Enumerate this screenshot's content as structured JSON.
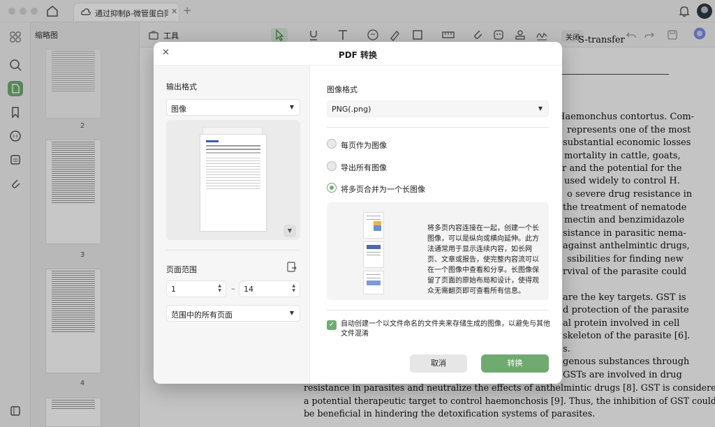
{
  "tab": {
    "title": "通过抑制β-微管蛋白同…"
  },
  "sidebar": {
    "thumbnails_title": "缩略图",
    "page_numbers": [
      "2",
      "3",
      "4"
    ]
  },
  "toolbar": {
    "tools_label": "工具",
    "close_label": "关闭"
  },
  "document": {
    "lines": [
      "S-transfer",
      "Haemonchus contortus. Com-",
      "represents one of the most",
      "substantial economic losses",
      "mortality in cattle, goats,",
      "r and the potential for the",
      "used widely to control H.",
      "o severe drug resistance in",
      "the treatment of nematode",
      "mectin and benzimidazole",
      "sistance in parasitic nema-",
      "against anthelmintic drugs,",
      "ssibilities for finding new",
      "rvival of the parasite could",
      "are the key targets. GST is",
      "d protection of the parasite",
      "al protein involved in cell",
      "skeleton of the parasite [6].",
      "s.",
      "genous substances through",
      "GSTs are involved in drug",
      "resistance in parasites and neutralize the effects of anthelmintic drugs [8]. GST is considered",
      "a potential therapeutic target to control haemonchosis [9]. Thus, the inhibition of GST could",
      "be beneficial in hindering the detoxification systems of parasites."
    ]
  },
  "dialog": {
    "title": "PDF 转换",
    "output_format_label": "输出格式",
    "output_format_value": "图像",
    "page_range_label": "页面范围",
    "page_from": "1",
    "page_to": "14",
    "range_dash": "–",
    "range_option": "范围中的所有页面",
    "image_format_label": "图像格式",
    "image_format_value": "PNG(.png)",
    "options": [
      {
        "label": "每页作为图像",
        "selected": false
      },
      {
        "label": "导出所有图像",
        "selected": false
      },
      {
        "label": "将多页合并为一个长图像",
        "selected": true
      }
    ],
    "description": "将多页内容连接在一起，创建一个长图像，可以是纵向或横向延伸。此方法通常用于显示连续内容，如长网页、文章或报告，使完整内容流可以在一个图像中查看和分享。长图像保留了页面的原始布局和设计，使得观众无需翻页即可查看所有信息。",
    "auto_folder_label": "自动创建一个以文件命名的文件夹来存储生成的图像，以避免与其他文件混淆",
    "auto_folder_checked": true,
    "cancel_label": "取消",
    "convert_label": "转换"
  },
  "colors": {
    "accent": "#6fab70"
  }
}
